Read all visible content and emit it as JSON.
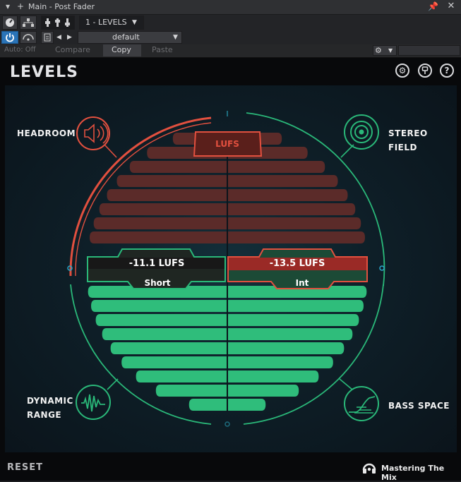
{
  "host": {
    "window_title": "Main - Post Fader",
    "insert_name": "1 - LEVELS",
    "preset_name": "default",
    "automation": "Auto: Off",
    "compare_label": "Compare",
    "copy_label": "Copy",
    "paste_label": "Paste"
  },
  "plugin": {
    "title": "LEVELS",
    "labels": {
      "headroom": "HEADROOM",
      "stereo_field": "STEREO FIELD",
      "dynamic_range_line1": "DYNAMIC",
      "dynamic_range_line2": "RANGE",
      "bass_space": "BASS SPACE"
    },
    "meter": {
      "center_label": "LUFS",
      "short_value": "-11.1 LUFS",
      "short_label": "Short",
      "int_value": "-13.5 LUFS",
      "int_label": "Int"
    },
    "reset_label": "RESET",
    "brand": "Mastering The Mix",
    "colors": {
      "red": "#e2503f",
      "green": "#2ab879",
      "red_bar": "#5b2b29",
      "green_bar": "#2fbd7b"
    }
  }
}
